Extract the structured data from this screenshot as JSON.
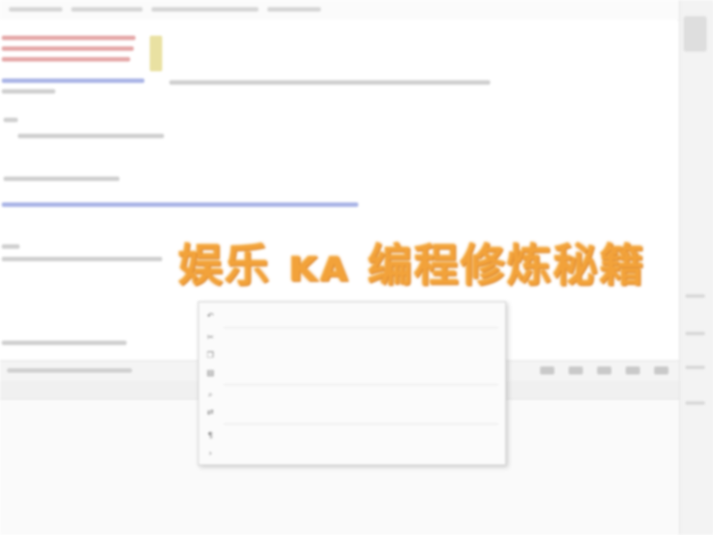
{
  "watermark": {
    "text": "娱乐 ᴋᴀ 编程修炼秘籍"
  },
  "context_menu": {
    "items": [
      {
        "label": "",
        "shortcut": "",
        "icon": "undo-icon"
      },
      {
        "label": "",
        "shortcut": "",
        "icon": "cut-icon"
      },
      {
        "label": "",
        "shortcut": "",
        "icon": "copy-icon"
      },
      {
        "label": "",
        "shortcut": "",
        "icon": "paste-icon"
      },
      {
        "label": "",
        "shortcut": "",
        "icon": "find-icon"
      },
      {
        "label": "",
        "shortcut": "",
        "icon": "replace-icon"
      },
      {
        "label": "",
        "shortcut": "",
        "icon": "format-icon"
      },
      {
        "label": "",
        "shortcut": "",
        "icon": "more-icon"
      }
    ]
  },
  "colors": {
    "watermark": "#f2a23a",
    "menu_bg": "#fbfbfb",
    "editor_bg": "#ffffff"
  }
}
